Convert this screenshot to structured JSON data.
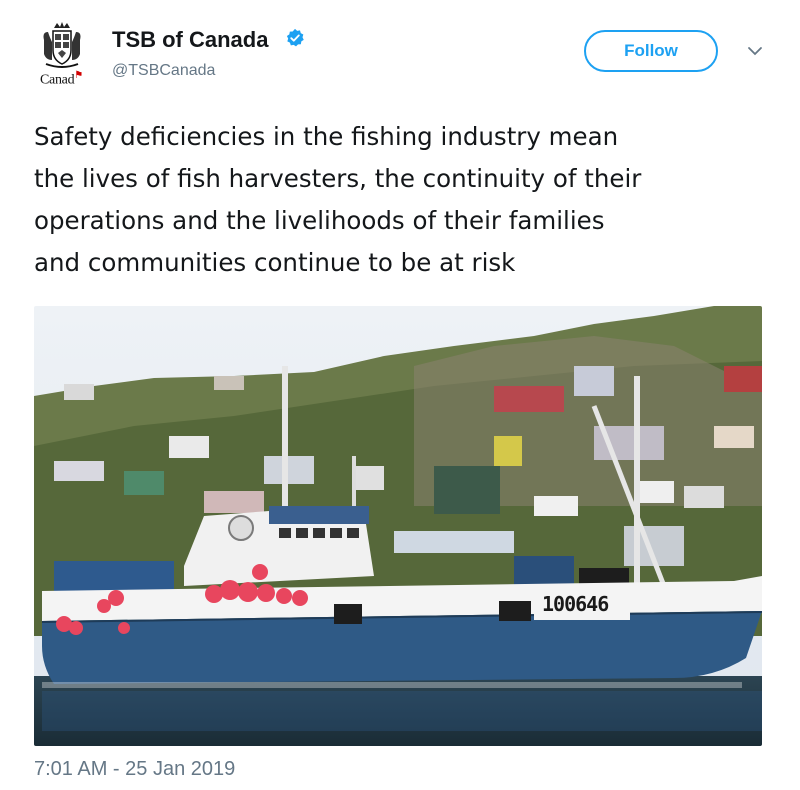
{
  "account": {
    "display_name": "TSB of Canada",
    "handle": "@TSBCanada",
    "logo_wordmark": "Canada",
    "verified_icon": "verified-badge-icon"
  },
  "actions": {
    "follow_label": "Follow",
    "more_icon": "chevron-down-icon"
  },
  "tweet": {
    "lines": [
      "Safety deficiencies in the fishing industry mean",
      "the lives of fish harvesters, the continuity of their",
      "operations and the livelihoods of their families",
      "and communities continue to be at risk"
    ]
  },
  "media": {
    "hull_number": "100646"
  },
  "timestamp": "7:01 AM - 25 Jan 2019",
  "colors": {
    "brand_blue": "#1da1f2",
    "text": "#14171a",
    "muted": "#657786",
    "hull_blue": "#2f5a86",
    "buoy_red": "#e8465e"
  }
}
